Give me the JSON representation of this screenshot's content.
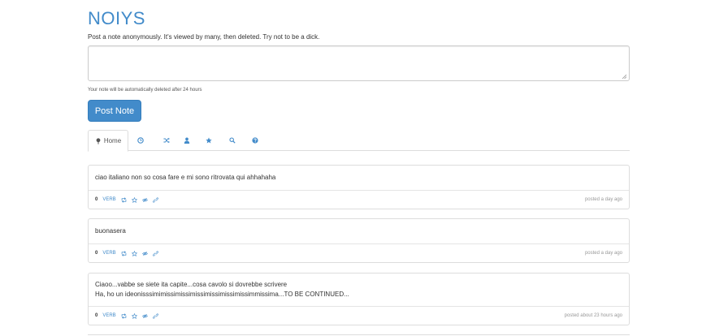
{
  "app": {
    "brand": "NOIYS",
    "tagline": "Post a note anonymously. It's viewed by many, then deleted. Try not to be a dick."
  },
  "composer": {
    "value": "",
    "placeholder": "",
    "helper": "Your note will be automatically deleted after 24 hours",
    "post_label": "Post Note"
  },
  "tabs": [
    {
      "label": "Home",
      "icon": "pushpin-icon",
      "active": true
    },
    {
      "label": "",
      "icon": "clock-icon"
    },
    {
      "label": "",
      "icon": "shuffle-icon"
    },
    {
      "label": "",
      "icon": "user-icon"
    },
    {
      "label": "",
      "icon": "star-icon"
    },
    {
      "label": "",
      "icon": "search-icon"
    },
    {
      "label": "",
      "icon": "question-icon"
    }
  ],
  "notes": [
    {
      "lines": [
        "ciao italiano non so cosa fare e mi sono ritrovata qui ahhahaha"
      ],
      "votes": "0",
      "verb": "VERB",
      "posted": "posted a day ago"
    },
    {
      "lines": [
        "buonasera"
      ],
      "votes": "0",
      "verb": "VERB",
      "posted": "posted a day ago"
    },
    {
      "lines": [
        "Ciaoo...vabbe se siete ita capite...cosa cavolo si dovrebbe scrivere",
        "Ha, ho un ideonisssimimissimissimissimissimissimissimmissima...TO BE CONTINUED..."
      ],
      "votes": "0",
      "verb": "VERB",
      "posted": "posted about 23 hours ago"
    }
  ],
  "colors": {
    "accent": "#428bca",
    "muted": "#999999",
    "border": "#dddddd"
  }
}
